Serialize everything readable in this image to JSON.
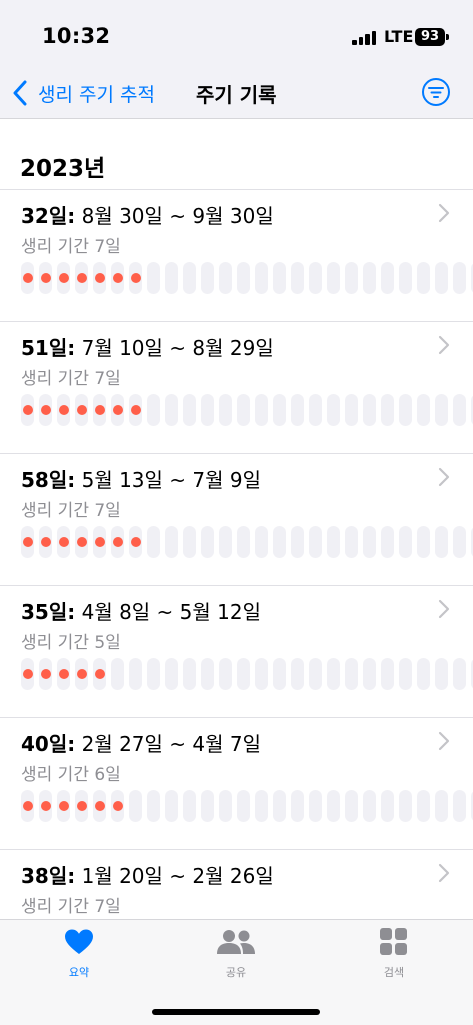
{
  "status_bar": {
    "time": "10:32",
    "carrier": "LTE",
    "battery": "93"
  },
  "nav": {
    "back_label": "생리 주기 추적",
    "title": "주기 기록",
    "filter_icon": "filter-icon"
  },
  "section": {
    "year": "2023년"
  },
  "cycles": [
    {
      "days": "32일:",
      "range": " 8월 30일 ~ 9월 30일",
      "period": "생리 기간 7일",
      "period_days": 7
    },
    {
      "days": "51일:",
      "range": " 7월 10일 ~ 8월 29일",
      "period": "생리 기간 7일",
      "period_days": 7
    },
    {
      "days": "58일:",
      "range": " 5월 13일 ~ 7월 9일",
      "period": "생리 기간 7일",
      "period_days": 7
    },
    {
      "days": "35일:",
      "range": " 4월 8일 ~ 5월 12일",
      "period": "생리 기간 5일",
      "period_days": 5
    },
    {
      "days": "40일:",
      "range": " 2월 27일 ~ 4월 7일",
      "period": "생리 기간 6일",
      "period_days": 6
    },
    {
      "days": "38일:",
      "range": " 1월 20일 ~ 2월 26일",
      "period": "생리 기간 7일",
      "period_days": 7
    }
  ],
  "tabs": [
    {
      "label": "요약",
      "icon": "heart-icon",
      "active": true
    },
    {
      "label": "공유",
      "icon": "people-icon",
      "active": false
    },
    {
      "label": "검색",
      "icon": "grid-icon",
      "active": false
    }
  ],
  "colors": {
    "accent": "#007aff",
    "period_dot": "#ff5f4a",
    "secondary_text": "#8e8e93"
  }
}
